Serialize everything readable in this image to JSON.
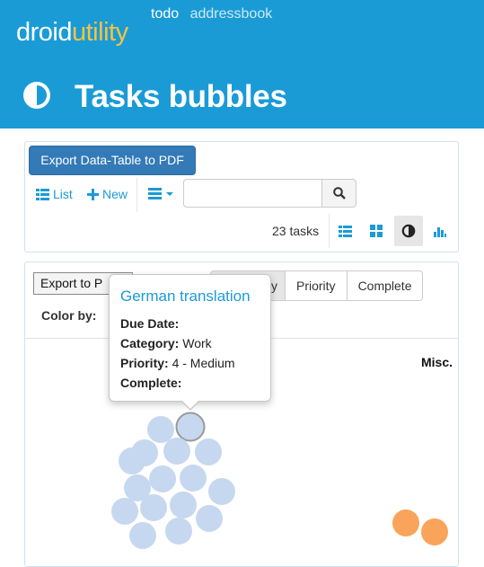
{
  "brand": {
    "part1": "droid",
    "part2": "utility"
  },
  "topnav": {
    "active": "todo",
    "link": "addressbook"
  },
  "page": {
    "title": "Tasks bubbles",
    "icon": "half-circle-contrast-icon"
  },
  "toolbar": {
    "export_pdf": "Export Data-Table to PDF",
    "list_label": "List",
    "new_label": "New",
    "search_value": "",
    "task_count": "23 tasks",
    "views": [
      "list-view-icon",
      "grid-view-icon",
      "bubbles-view-icon",
      "bar-chart-icon"
    ],
    "active_view": "bubbles-view-icon"
  },
  "bubbles": {
    "export_png_label": "Export to P",
    "group_buttons": [
      "y",
      "Priority",
      "Complete"
    ],
    "color_by_label": "Color by:",
    "group_label": "Misc.",
    "colors": {
      "default": "#c6d8f0",
      "highlight": "#f9a45a",
      "selected_stroke": "#999999"
    }
  },
  "tooltip": {
    "title": "German translation",
    "due_date_label": "Due Date:",
    "due_date_value": "",
    "category_label": "Category:",
    "category_value": "Work",
    "priority_label": "Priority:",
    "priority_value": "4 - Medium",
    "complete_label": "Complete:",
    "complete_value": ""
  },
  "colors": {
    "header": "#1a9bd6",
    "brand_accent": "#f5c342",
    "primary_button": "#337ab7"
  }
}
